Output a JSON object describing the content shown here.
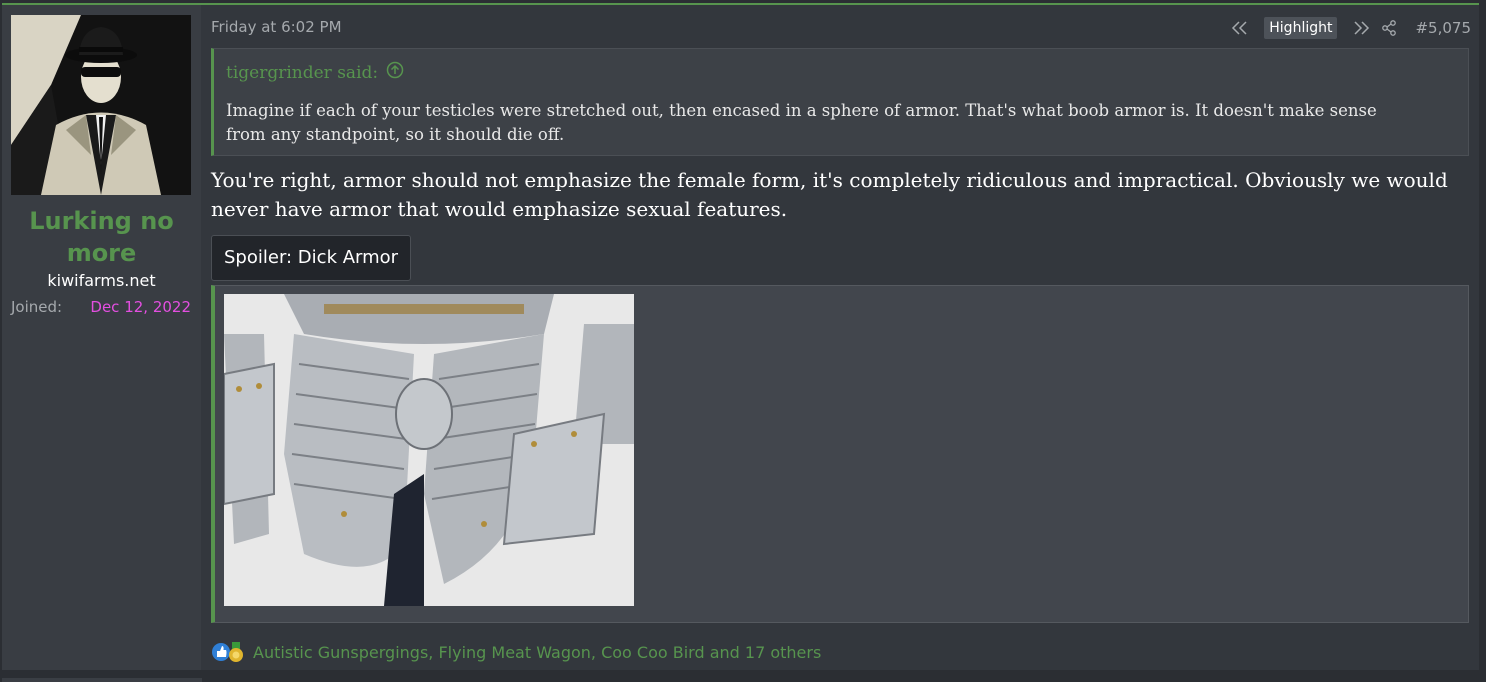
{
  "user": {
    "name": "Lurking no more",
    "title": "kiwifarms.net",
    "joined_label": "Joined:",
    "joined_value": "Dec 12, 2022"
  },
  "post": {
    "time": "Friday at 6:02 PM",
    "highlight_label": "Highlight",
    "number": "#5,075",
    "quote": {
      "author": "tigergrinder said:",
      "body": "Imagine if each of your testicles were stretched out, then encased in a sphere of armor. That's what boob armor is. It doesn't make sense from any standpoint, so it should die off."
    },
    "body": "You're right, armor should not emphasize the female form, it's completely ridiculous and impractical. Obviously we would never have armor that would emphasize sexual features.",
    "spoiler_label": "Spoiler: Dick Armor",
    "reactions_text": "Autistic Gunspergings, Flying Meat Wagon, Coo Coo Bird and 17 others"
  },
  "icons": {
    "rewind": "rewind-icon",
    "forward": "fast-forward-icon",
    "share": "share-icon",
    "quote_up": "arrow-up-circle-icon",
    "like": "thumbs-up-icon",
    "medal": "medal-icon"
  },
  "colors": {
    "accent_green": "#57944e",
    "joined_pink": "#e34fe0",
    "post_bg": "#33373d",
    "sidebar_bg": "#393d43"
  }
}
